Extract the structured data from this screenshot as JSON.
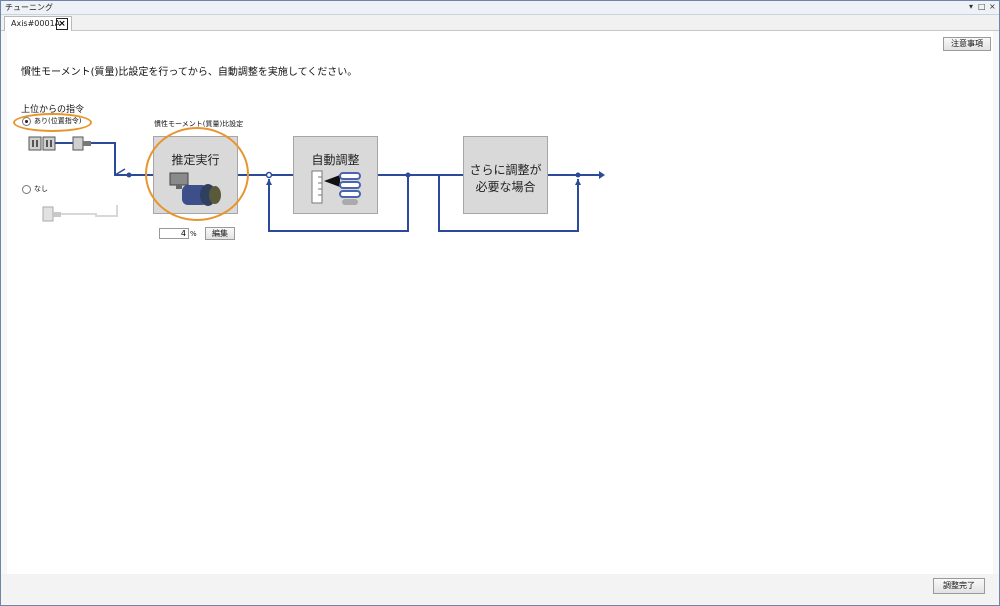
{
  "window": {
    "title": "チューニング",
    "controls": [
      "▾",
      "□",
      "×"
    ]
  },
  "tab": {
    "label": "Axis#0001A",
    "close": "×"
  },
  "header": {
    "notes_button": "注意事項"
  },
  "instruction": "慣性モーメント(質量)比設定を行ってから、自動調整を実施してください。",
  "command_source": {
    "label": "上位からの指令",
    "options": [
      {
        "label": "あり(位置指令)",
        "selected": true
      },
      {
        "label": "なし",
        "selected": false
      }
    ]
  },
  "inertia": {
    "section_label": "慣性モーメント(質量)比設定",
    "button_label": "推定実行",
    "value": "4",
    "unit": "%",
    "edit_button": "編集"
  },
  "auto_tune": {
    "button_label": "自動調整"
  },
  "further": {
    "button_label_line1": "さらに調整が",
    "button_label_line2": "必要な場合"
  },
  "footer": {
    "finish_button": "調整完了"
  },
  "colors": {
    "flow_line": "#2b4a9a",
    "highlight": "#e8952e",
    "box_fill": "#d9d9d9"
  }
}
